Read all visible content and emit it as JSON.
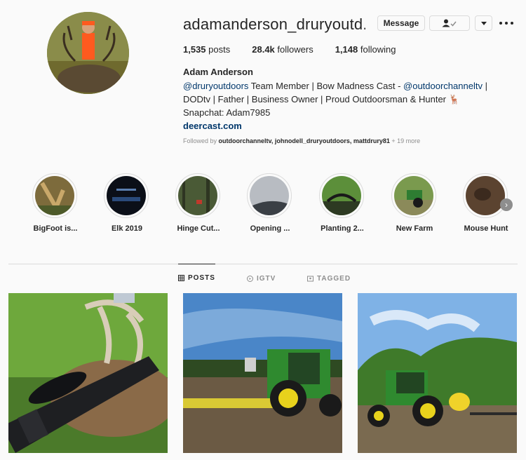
{
  "profile": {
    "username": "adamanderson_druryoutd...",
    "message_label": "Message",
    "posts_count": "1,535",
    "posts_label": "posts",
    "followers_count": "28.4k",
    "followers_label": "followers",
    "following_count": "1,148",
    "following_label": "following",
    "full_name": "Adam Anderson",
    "bio_mention_1": "@druryoutdoors",
    "bio_text_1": " Team Member | Bow Madness Cast - ",
    "bio_mention_2": "@outdoorchanneltv",
    "bio_text_1_end": " |",
    "bio_line_2": "DODtv | Father | Business Owner | Proud Outdoorsman & Hunter 🦌",
    "bio_line_3": "Snapchat: Adam7985",
    "website": "deercast.com",
    "followed_by_prefix": "Followed by ",
    "followed_by_names": "outdoorchanneltv, johnodell_druryoutdoors, mattdrury81",
    "followed_by_suffix": " + 19 more"
  },
  "highlights": [
    {
      "label": "BigFoot is..."
    },
    {
      "label": "Elk 2019"
    },
    {
      "label": "Hinge Cut..."
    },
    {
      "label": "Opening ..."
    },
    {
      "label": "Planting 2..."
    },
    {
      "label": "New Farm"
    },
    {
      "label": "Mouse Hunt"
    }
  ],
  "tabs": {
    "posts": "POSTS",
    "igtv": "IGTV",
    "tagged": "TAGGED"
  },
  "colors": {
    "link": "#00376b",
    "muted": "#8e8e8e",
    "border": "#dbdbdb",
    "background": "#fafafa"
  }
}
